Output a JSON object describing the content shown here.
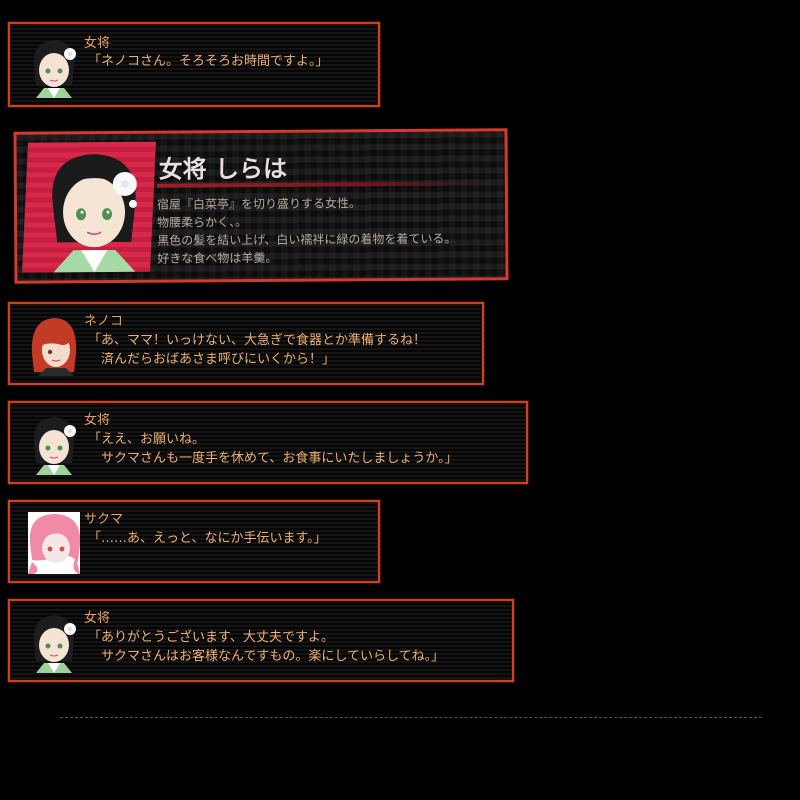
{
  "colors": {
    "frame_border": "#c9431f",
    "speaker_text": "#e8a060",
    "dialogue_text": "#efb074",
    "profile_border": "#d43a2e",
    "profile_portrait_bg": "#d8294a",
    "profile_desc_text": "#b8a8a0"
  },
  "dialogues": [
    {
      "speaker": "女将",
      "avatar": "okami-avatar",
      "lines": [
        "「ネノコさん。そろそろお時間ですよ。」"
      ]
    },
    {
      "speaker": "ネノコ",
      "avatar": "nenoko-avatar",
      "lines": [
        "「あ、ママ！いっけない、大急ぎで食器とか準備するね！",
        "　済んだらおばあさま呼びにいくから！」"
      ]
    },
    {
      "speaker": "女将",
      "avatar": "okami-avatar",
      "lines": [
        "「ええ、お願いね。",
        "　サクマさんも一度手を休めて、お食事にいたしましょうか。」"
      ]
    },
    {
      "speaker": "サクマ",
      "avatar": "sakuma-avatar",
      "lines": [
        "「……あ、えっと、なにか手伝います。」"
      ]
    },
    {
      "speaker": "女将",
      "avatar": "okami-avatar",
      "lines": [
        "「ありがとうございます、大丈夫ですよ。",
        "　サクマさんはお客様なんですもの。楽にしていらしてね。」"
      ]
    }
  ],
  "profile": {
    "name": "女将 しらは",
    "description": [
      "宿屋『白菜亭』を切り盛りする女性。",
      "物腰柔らかく、。",
      "黒色の髪を結い上げ、白い襦袢に緑の着物を着ている。",
      "好きな食べ物は羊羹。"
    ]
  }
}
